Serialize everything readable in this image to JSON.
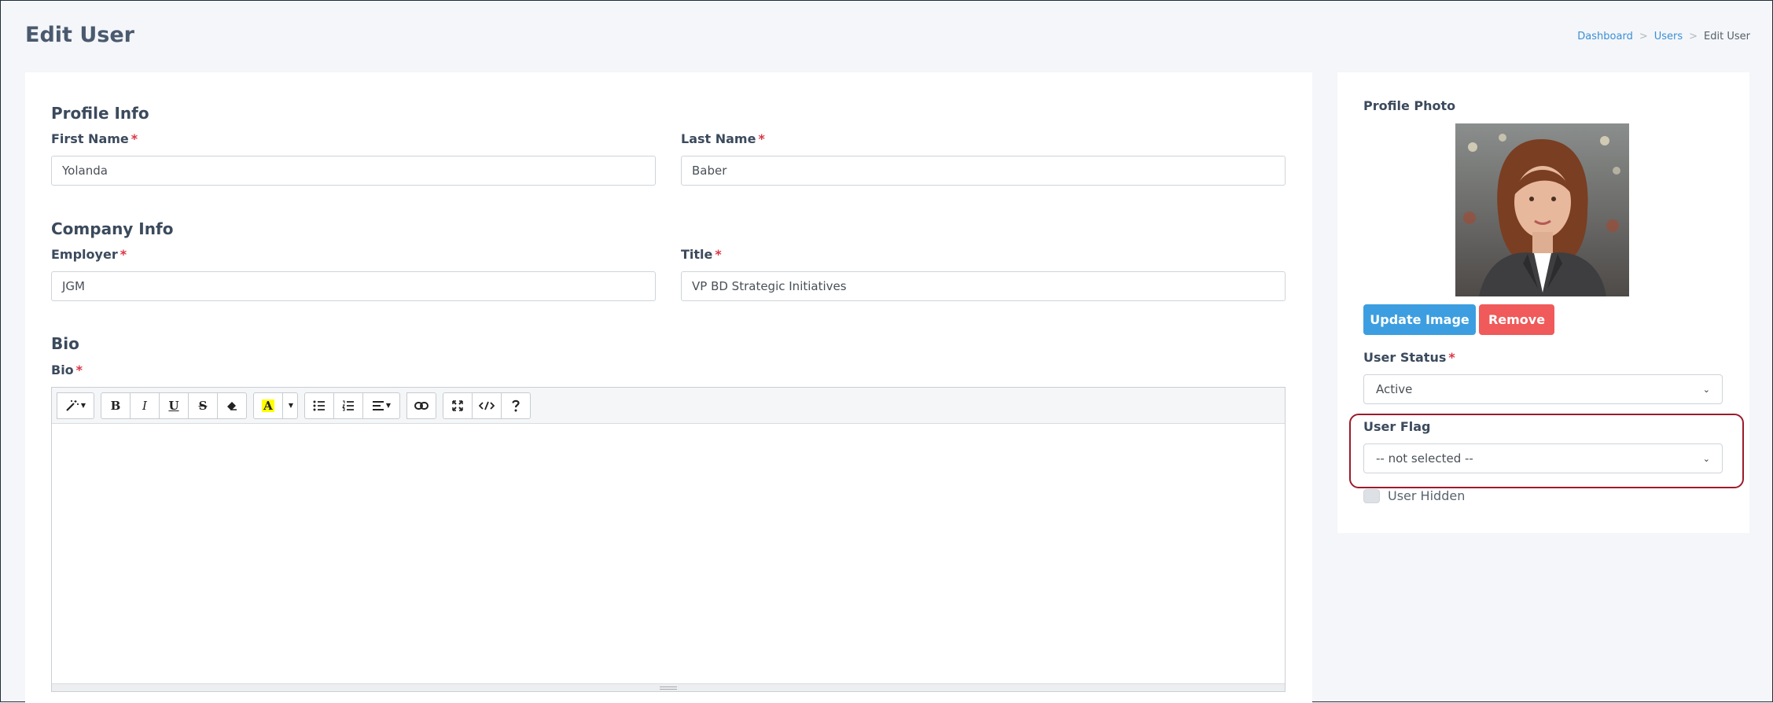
{
  "header": {
    "title": "Edit User",
    "breadcrumb": {
      "home": "Dashboard",
      "section": "Users",
      "current": "Edit User",
      "separator": ">"
    }
  },
  "profile": {
    "section_title": "Profile Info",
    "first_name": {
      "label": "First Name",
      "value": "Yolanda"
    },
    "last_name": {
      "label": "Last Name",
      "value": "Baber"
    }
  },
  "company": {
    "section_title": "Company Info",
    "employer": {
      "label": "Employer",
      "value": "JGM"
    },
    "title": {
      "label": "Title",
      "value": "VP BD Strategic Initiatives"
    }
  },
  "bio": {
    "section_title": "Bio",
    "label": "Bio",
    "toolbar": {
      "bold": "B",
      "italic": "I",
      "underline": "U",
      "strike": "S",
      "highlight": "A",
      "icons": [
        "magic-icon",
        "eraser-icon",
        "list-unordered-icon",
        "list-ordered-icon",
        "align-icon",
        "link-icon",
        "fullscreen-icon",
        "code-icon",
        "help-icon"
      ]
    },
    "value": ""
  },
  "sidebar": {
    "photo_label": "Profile Photo",
    "update_image": "Update Image",
    "remove": "Remove",
    "user_status": {
      "label": "User Status",
      "selected": "Active"
    },
    "user_flag": {
      "label": "User Flag",
      "selected": "-- not selected --"
    },
    "user_hidden": {
      "label": "User Hidden",
      "checked": false
    }
  },
  "colors": {
    "primary": "#3c9ee0",
    "danger": "#f05a5a",
    "required": "#dc3545",
    "highlight_box": "#9b1b2b",
    "link": "#3a8fd6"
  }
}
